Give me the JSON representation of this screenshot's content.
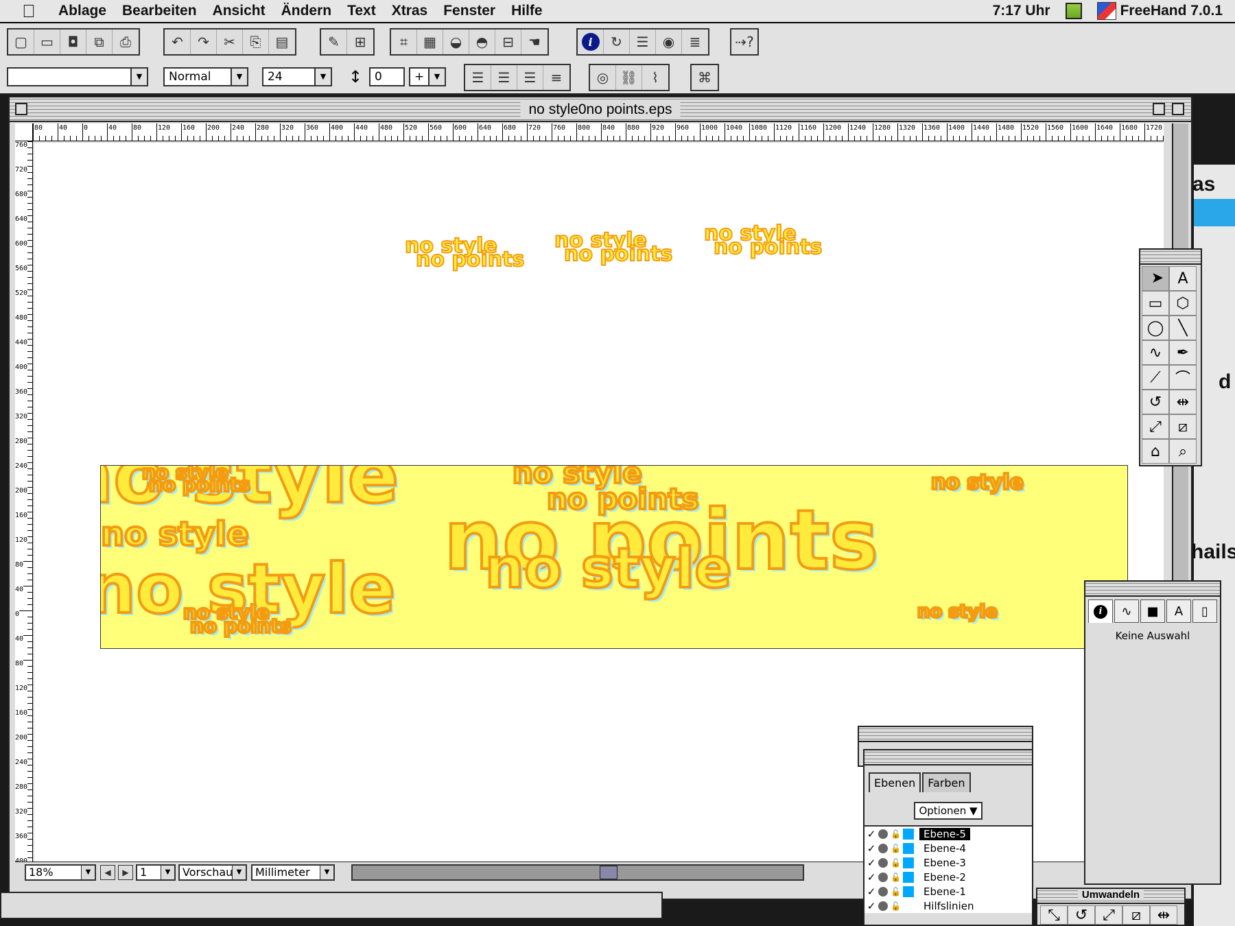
{
  "menubar": {
    "apple": "",
    "items": [
      "Ablage",
      "Bearbeiten",
      "Ansicht",
      "Ändern",
      "Text",
      "Xtras",
      "Fenster",
      "Hilfe"
    ],
    "clock": "7:17 Uhr",
    "app_name": "FreeHand 7.0.1"
  },
  "toolbar2": {
    "font_value": "",
    "style_value": "Normal",
    "size_value": "24",
    "leading_value": "0",
    "leading_mode": "+"
  },
  "document": {
    "title": "no style0no points.eps",
    "ruler_h": [
      "80",
      "40",
      "0",
      "40",
      "80",
      "120",
      "160",
      "200",
      "240",
      "280",
      "320",
      "360",
      "400",
      "440",
      "480",
      "520",
      "560",
      "600",
      "640",
      "680",
      "720",
      "760",
      "800",
      "840",
      "880",
      "920",
      "960",
      "1000",
      "1040",
      "1080",
      "1120",
      "1160",
      "1200",
      "1240",
      "1280",
      "1320",
      "1360",
      "1400",
      "1440",
      "1480",
      "1520",
      "1560",
      "1600",
      "1640",
      "1680",
      "1720"
    ],
    "ruler_v": [
      "760",
      "720",
      "680",
      "640",
      "600",
      "560",
      "520",
      "480",
      "440",
      "400",
      "360",
      "320",
      "280",
      "240",
      "200",
      "160",
      "120",
      "80",
      "40",
      "0",
      "40",
      "80",
      "120",
      "160",
      "200",
      "240",
      "280",
      "320",
      "360",
      "400"
    ],
    "art_small": [
      "no style",
      "no points",
      "no style",
      "no points",
      "no style",
      "no points"
    ],
    "art_big": [
      "no style",
      "no points"
    ]
  },
  "status": {
    "zoom": "18%",
    "page": "1",
    "view_mode": "Vorschau",
    "units": "Millimeter"
  },
  "inspector": {
    "selection_text": "Keine Auswahl"
  },
  "layers_panel": {
    "tabs": [
      "Ebenen",
      "Farben"
    ],
    "options_label": "Optionen",
    "layers": [
      "Ebene-5",
      "Ebene-4",
      "Ebene-3",
      "Ebene-2",
      "Ebene-1",
      "Hilfslinien"
    ],
    "active_layer": "Ebene-5"
  },
  "transform_panel": {
    "title": "Umwandeln"
  },
  "background_fragments": [
    "as",
    "d",
    "hails"
  ],
  "colors": {
    "art_fill": "#ffeb3b",
    "art_stroke": "#f39c12",
    "art_glow": "#a6eeee",
    "layer_swatch": "#00a8ff"
  }
}
